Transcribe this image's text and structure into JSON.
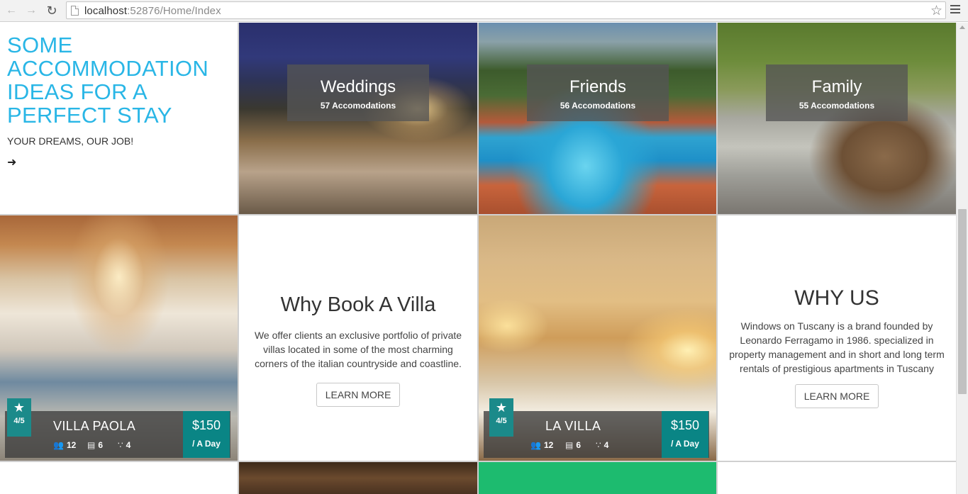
{
  "browser": {
    "url_host": "localhost",
    "url_path": ":52876/Home/Index"
  },
  "intro": {
    "headline": "SOME ACCOMMODATION IDEAS FOR A PERFECT STAY",
    "tagline": "YOUR DREAMS, OUR JOB!"
  },
  "categories": [
    {
      "title": "Weddings",
      "count": "57 Accomodations"
    },
    {
      "title": "Friends",
      "count": "56 Accomodations"
    },
    {
      "title": "Family",
      "count": "55 Accomodations"
    }
  ],
  "why_book": {
    "title": "Why Book A Villa",
    "body": "We offer clients an exclusive portfolio of private villas located in some of the most charming corners of the italian countryside and coastline.",
    "button": "LEARN MORE"
  },
  "why_us": {
    "title": "WHY US",
    "body": "Windows on Tuscany is a brand founded by Leonardo Ferragamo in 1986. specialized in property management and in short and long term rentals of prestigious apartments in Tuscany",
    "button": "LEARN MORE"
  },
  "villas": [
    {
      "name": "VILLA PAOLA",
      "rating": "4/5",
      "guests": "12",
      "beds": "6",
      "baths": "4",
      "price": "$150",
      "per": "/ A Day"
    },
    {
      "name": "LA VILLA",
      "rating": "4/5",
      "guests": "12",
      "beds": "6",
      "baths": "4",
      "price": "$150",
      "per": "/ A Day"
    }
  ],
  "colors": {
    "accent_blue": "#29b6e6",
    "teal": "#1b8a8a",
    "green_tile": "#1dbb6f"
  },
  "icons": [
    "back-arrow-icon",
    "forward-arrow-icon",
    "reload-icon",
    "page-icon",
    "star-icon",
    "menu-icon",
    "right-arrow-icon",
    "rating-star-icon",
    "guests-icon",
    "bed-icon",
    "shower-icon"
  ]
}
